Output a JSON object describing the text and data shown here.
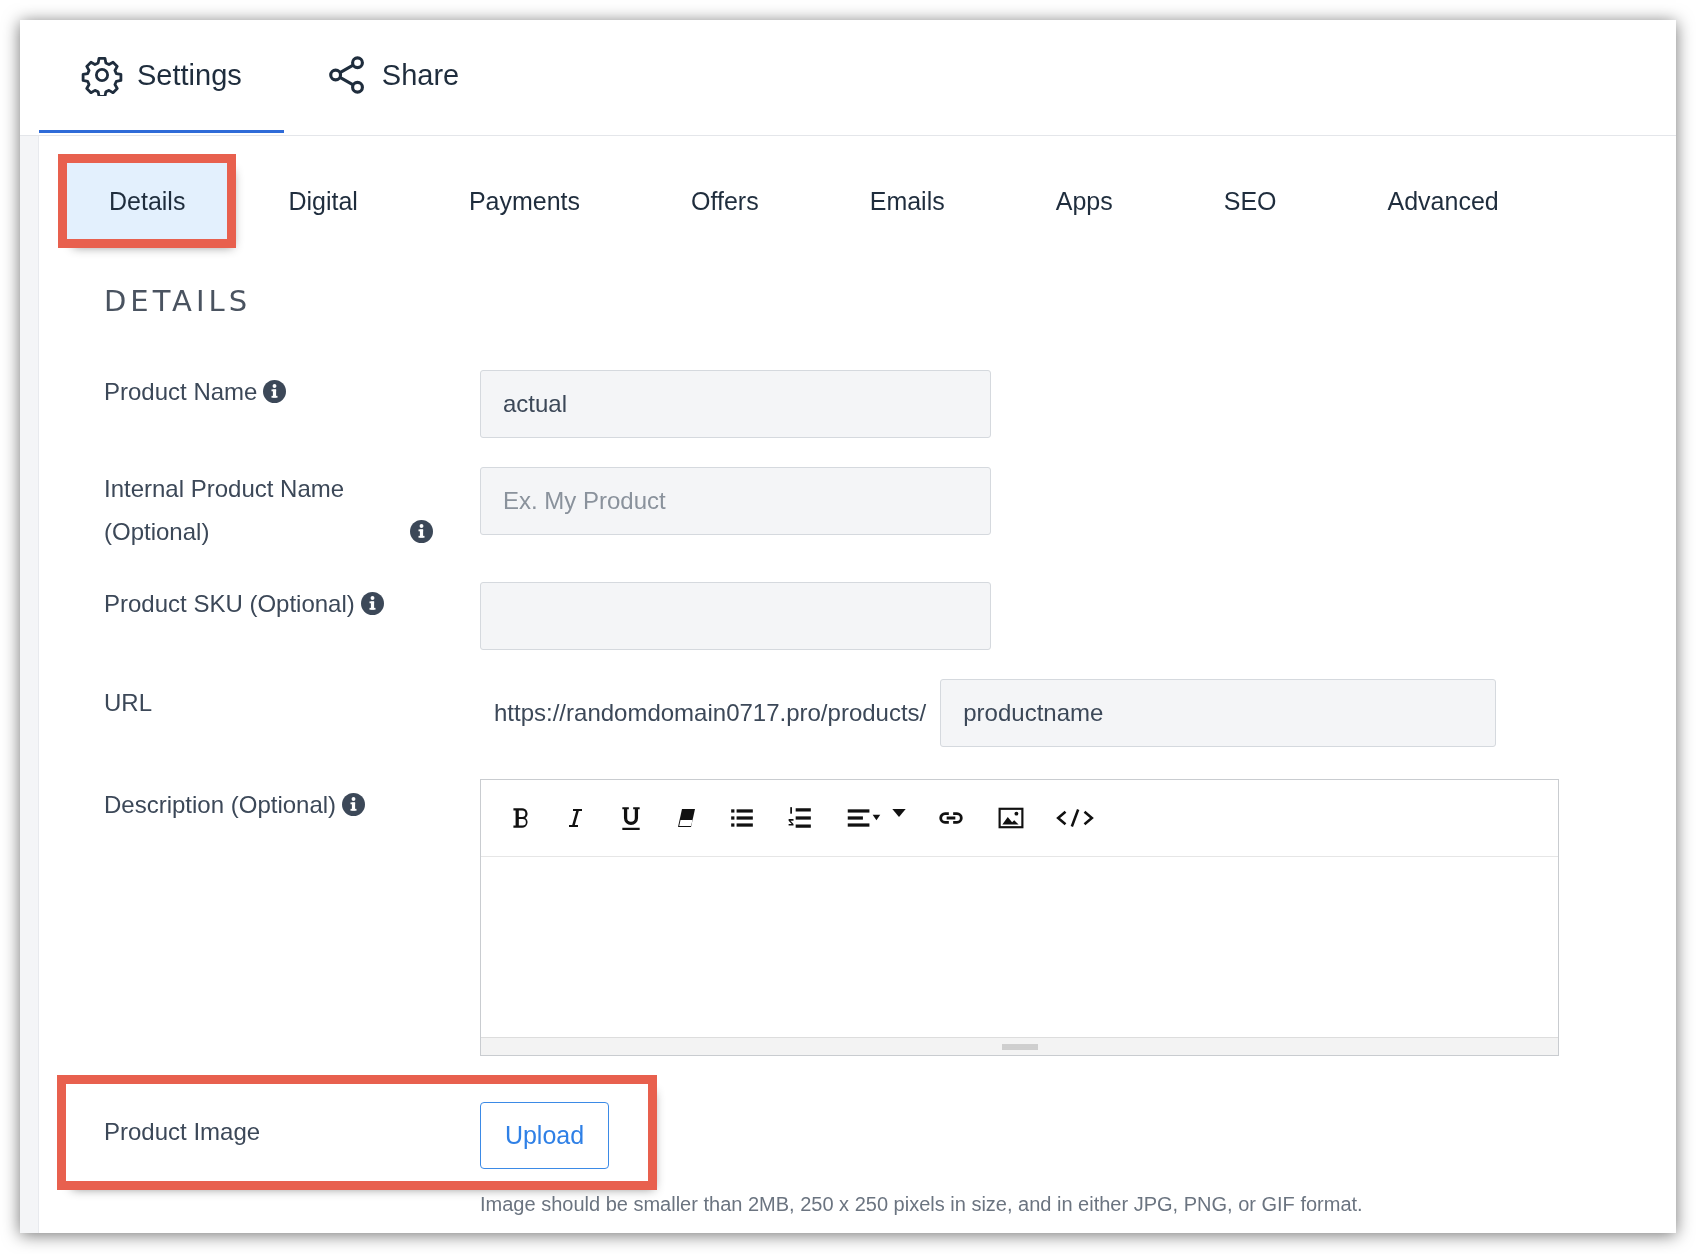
{
  "top_tabs": [
    {
      "label": "Settings",
      "selected": true
    },
    {
      "label": "Share",
      "selected": false
    }
  ],
  "sub_tabs": [
    {
      "label": "Details",
      "selected": true,
      "highlighted": true
    },
    {
      "label": "Digital",
      "selected": false,
      "highlighted": false
    },
    {
      "label": "Payments",
      "selected": false,
      "highlighted": false
    },
    {
      "label": "Offers",
      "selected": false,
      "highlighted": false
    },
    {
      "label": "Emails",
      "selected": false,
      "highlighted": false
    },
    {
      "label": "Apps",
      "selected": false,
      "highlighted": false
    },
    {
      "label": "SEO",
      "selected": false,
      "highlighted": false
    },
    {
      "label": "Advanced",
      "selected": false,
      "highlighted": false
    }
  ],
  "heading": "DETAILS",
  "fields": [
    {
      "kind": "text",
      "label": "Product Name",
      "info": true,
      "value": "actual"
    },
    {
      "kind": "text",
      "label": "Internal Product Name (Optional)",
      "info": true,
      "placeholder": "Ex. My Product"
    },
    {
      "kind": "text",
      "label": "Product SKU (Optional)",
      "info": true
    },
    {
      "kind": "url",
      "label": "URL",
      "info": false,
      "prefix": "https://randomdomain0717.pro/products/",
      "value": "productname"
    },
    {
      "kind": "editor",
      "label": "Description (Optional)",
      "info": true
    },
    {
      "kind": "upload",
      "label": "Product Image",
      "info": false,
      "highlighted": true,
      "button": "Upload",
      "hint": "Image should be smaller than 2MB, 250 x 250 pixels in size, and in either JPG, PNG, or GIF format."
    }
  ]
}
